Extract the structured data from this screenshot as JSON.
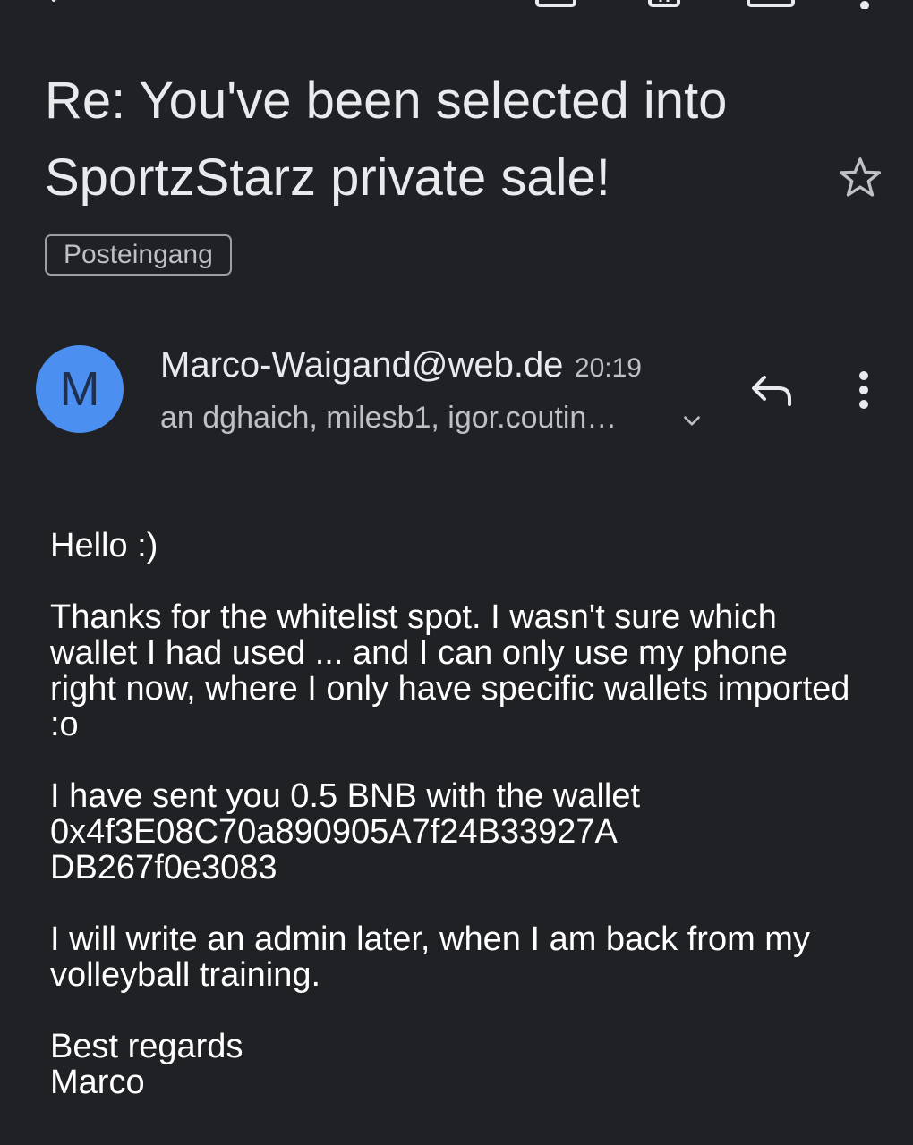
{
  "icons": {
    "back": "arrow-back-icon",
    "archive": "archive-icon",
    "delete": "trash-icon",
    "mark_unread": "mail-icon",
    "overflow_top": "more-vert-icon",
    "star": "star-outline-icon",
    "reply": "reply-icon",
    "message_more": "more-vert-icon",
    "expand": "chevron-down-icon"
  },
  "colors": {
    "background": "#202124",
    "avatar": "#4b8ff0",
    "text_primary": "#e8eaed",
    "text_secondary": "#bdc1c6"
  },
  "email": {
    "subject": "Re: You've been selected into SportzStarz private sale!",
    "label": "Posteingang",
    "sender": {
      "avatar_letter": "M",
      "address": "Marco-Waigand@web.de",
      "time": "20:19",
      "recipients": "an dghaich, milesb1, igor.coutin…"
    },
    "body": {
      "greeting": "Hello :)",
      "para1": "Thanks for the whitelist spot. I wasn't sure which wallet I had used ... and I can only use my phone right now, where I only have specific wallets imported :o",
      "para2_line1": "I have sent you 0.5 BNB with the wallet",
      "para2_line2": "0x4f3E08C70a890905A7f24B33927A",
      "para2_line3": "DB267f0e3083",
      "para3": "I will write an admin later, when I am back from my volleyball training.",
      "closing": "Best regards",
      "signature": "Marco"
    }
  }
}
